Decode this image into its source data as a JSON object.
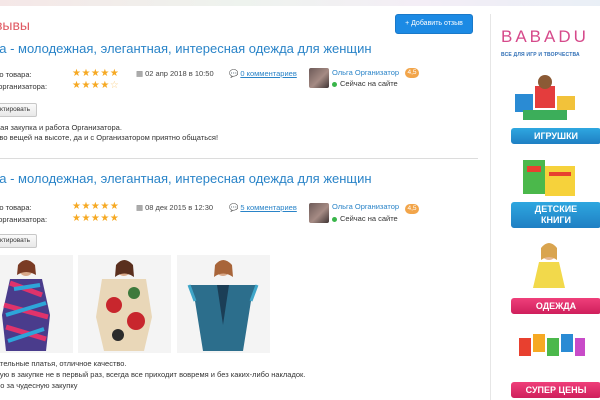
{
  "page": {
    "heading": "зывы",
    "add_button": "+ Добавить отзыв"
  },
  "reviews": [
    {
      "title": "La - молодежная, элегантная, интересная одежда для женщин",
      "quality_label": "тво товара:",
      "organizer_label": "а организатора:",
      "quality_stars": "★★★★★",
      "organizer_stars": "★★★★",
      "organizer_stars_empty": "☆",
      "date": "02 апр 2018 в 10:50",
      "comments": "0 комментариев",
      "author": "Ольга Организатор",
      "author_badge": "4,5",
      "online": "Сейчас на сайте",
      "edit_button": "ктировать",
      "lines": [
        "ная закупка и работа Организатора.",
        "тво вещей на высоте, да и с Организатором приятно общаться!"
      ]
    },
    {
      "title": "La - молодежная, элегантная, интересная одежда для женщин",
      "quality_label": "тво товара:",
      "organizer_label": "а организатора:",
      "quality_stars": "★★★★★",
      "organizer_stars": "★★★★★",
      "organizer_stars_empty": "",
      "date": "08 дек 2015 в 12:30",
      "comments": "5 комментариев",
      "author": "Ольга Организатор",
      "author_badge": "4,5",
      "online": "Сейчас на сайте",
      "edit_button": "ктировать",
      "lines": [
        "ательные платья, отличное качество.",
        "вую в закупке не в первый раз, всегда все приходит вовремя и без каких-либо накладок.",
        "бо за чудесную закупку"
      ]
    }
  ],
  "icons": {
    "calendar": "calendar-icon",
    "comment": "comment-icon",
    "star": "star-icon"
  },
  "sidebar": {
    "logo": "BABADU",
    "tagline": "ВСЕ ДЛЯ ИГР И ТВОРЧЕСТВА",
    "promos": [
      {
        "label": "ИГРУШКИ",
        "color": "#1f8fd3"
      },
      {
        "label": "ДЕТСКИЕ\nКНИГИ",
        "color": "#1f8fd3"
      },
      {
        "label": "ОДЕЖДА",
        "color": "#e0306d"
      },
      {
        "label": "СУПЕР ЦЕНЫ",
        "color": "#e0306d"
      }
    ]
  },
  "colors": {
    "accent_blue": "#2a84c8",
    "button_blue": "#1c8ae4",
    "heading_red": "#e05a63",
    "star_orange": "#f6a923",
    "online_green": "#39b54a",
    "badge_orange": "#f2a54a"
  }
}
